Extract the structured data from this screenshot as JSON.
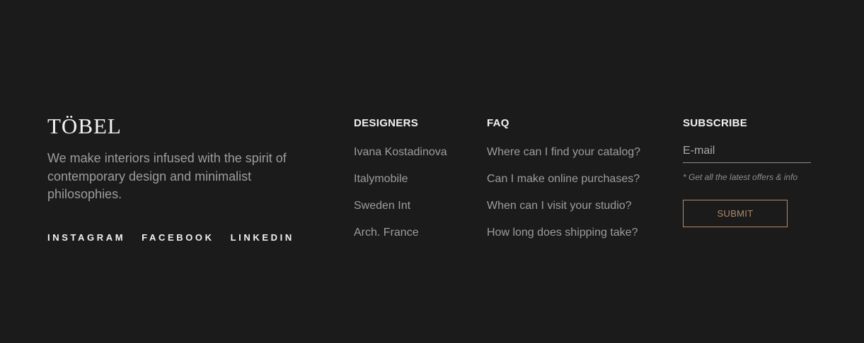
{
  "brand": {
    "logo": "TÖBEL",
    "tagline": "We make interiors infused with the spirit of contemporary design and minimalist philosophies."
  },
  "social": {
    "links": [
      "INSTAGRAM",
      "FACEBOOK",
      "LINKEDIN"
    ]
  },
  "designers": {
    "heading": "DESIGNERS",
    "items": [
      "Ivana Kostadinova",
      "Italymobile",
      "Sweden Int",
      "Arch. France"
    ]
  },
  "faq": {
    "heading": "FAQ",
    "items": [
      "Where can I find your catalog?",
      "Can I make online purchases?",
      "When can I visit your studio?",
      "How long does shipping take?"
    ]
  },
  "subscribe": {
    "heading": "SUBSCRIBE",
    "email_placeholder": "E-mail",
    "note": "* Get all the latest offers & info",
    "submit_label": "SUBMIT"
  },
  "colors": {
    "background": "#1b1b1b",
    "accent": "#b08b6a",
    "heading": "#f2f2f2",
    "body_text": "#9d9d9d"
  }
}
